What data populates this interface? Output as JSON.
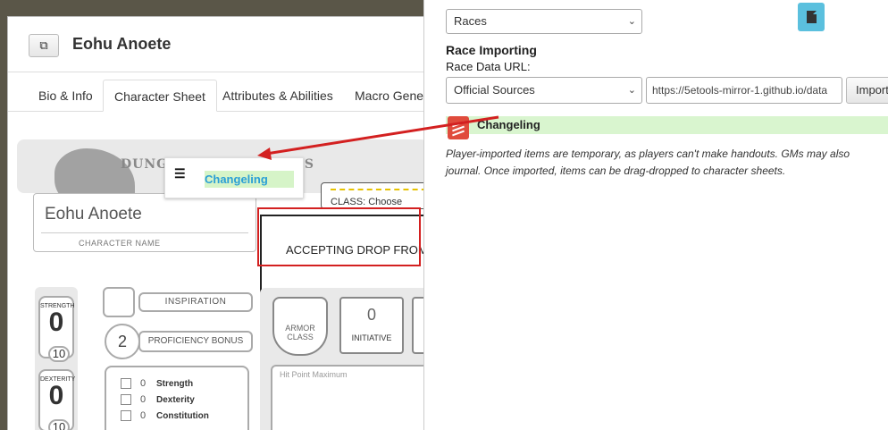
{
  "character": {
    "window_title": "Eohu Anoete",
    "tabs": [
      "Bio & Info",
      "Character Sheet",
      "Attributes & Abilities",
      "Macro Generator"
    ],
    "sheet": {
      "logo_text": "DUNGEONS & DRAGONS",
      "name": "Eohu Anoete",
      "name_caption": "CHARACTER NAME",
      "class_label": "CLASS:",
      "class_value": "Choose",
      "drop_text": "ACCEPTING DROP FROM",
      "abilities": [
        {
          "name": "STRENGTH",
          "score": "0",
          "mod": "10"
        },
        {
          "name": "DEXTERITY",
          "score": "0",
          "mod": "10"
        }
      ],
      "inspiration_label": "INSPIRATION",
      "proficiency_value": "2",
      "proficiency_label": "PROFICIENCY BONUS",
      "saves": [
        {
          "value": "0",
          "label": "Strength"
        },
        {
          "value": "0",
          "label": "Dexterity"
        },
        {
          "value": "0",
          "label": "Constitution"
        }
      ],
      "armor_label": "ARMOR CLASS",
      "initiative_value": "0",
      "initiative_label": "INITIATIVE",
      "hp_label": "Hit Point Maximum"
    }
  },
  "drag_item": {
    "handle": "☰",
    "name": "Changeling"
  },
  "importer": {
    "category_select": "Races",
    "section_title": "Race Importing",
    "url_label": "Race Data URL:",
    "source_select": "Official Sources",
    "url_value": "https://5etools-mirror-1.github.io/data",
    "import_button": "Import",
    "result_name": "Changeling",
    "note_line1": "Player-imported items are temporary, as players can't make handouts. GMs may also",
    "note_line2": "journal. Once imported, items can be drag-dropped to character sheets."
  },
  "colors": {
    "highlight_green": "#d9f5cf",
    "drag_text_blue": "#2a9fd6",
    "annotation_red": "#d32020",
    "doc_button": "#5bc0de"
  }
}
